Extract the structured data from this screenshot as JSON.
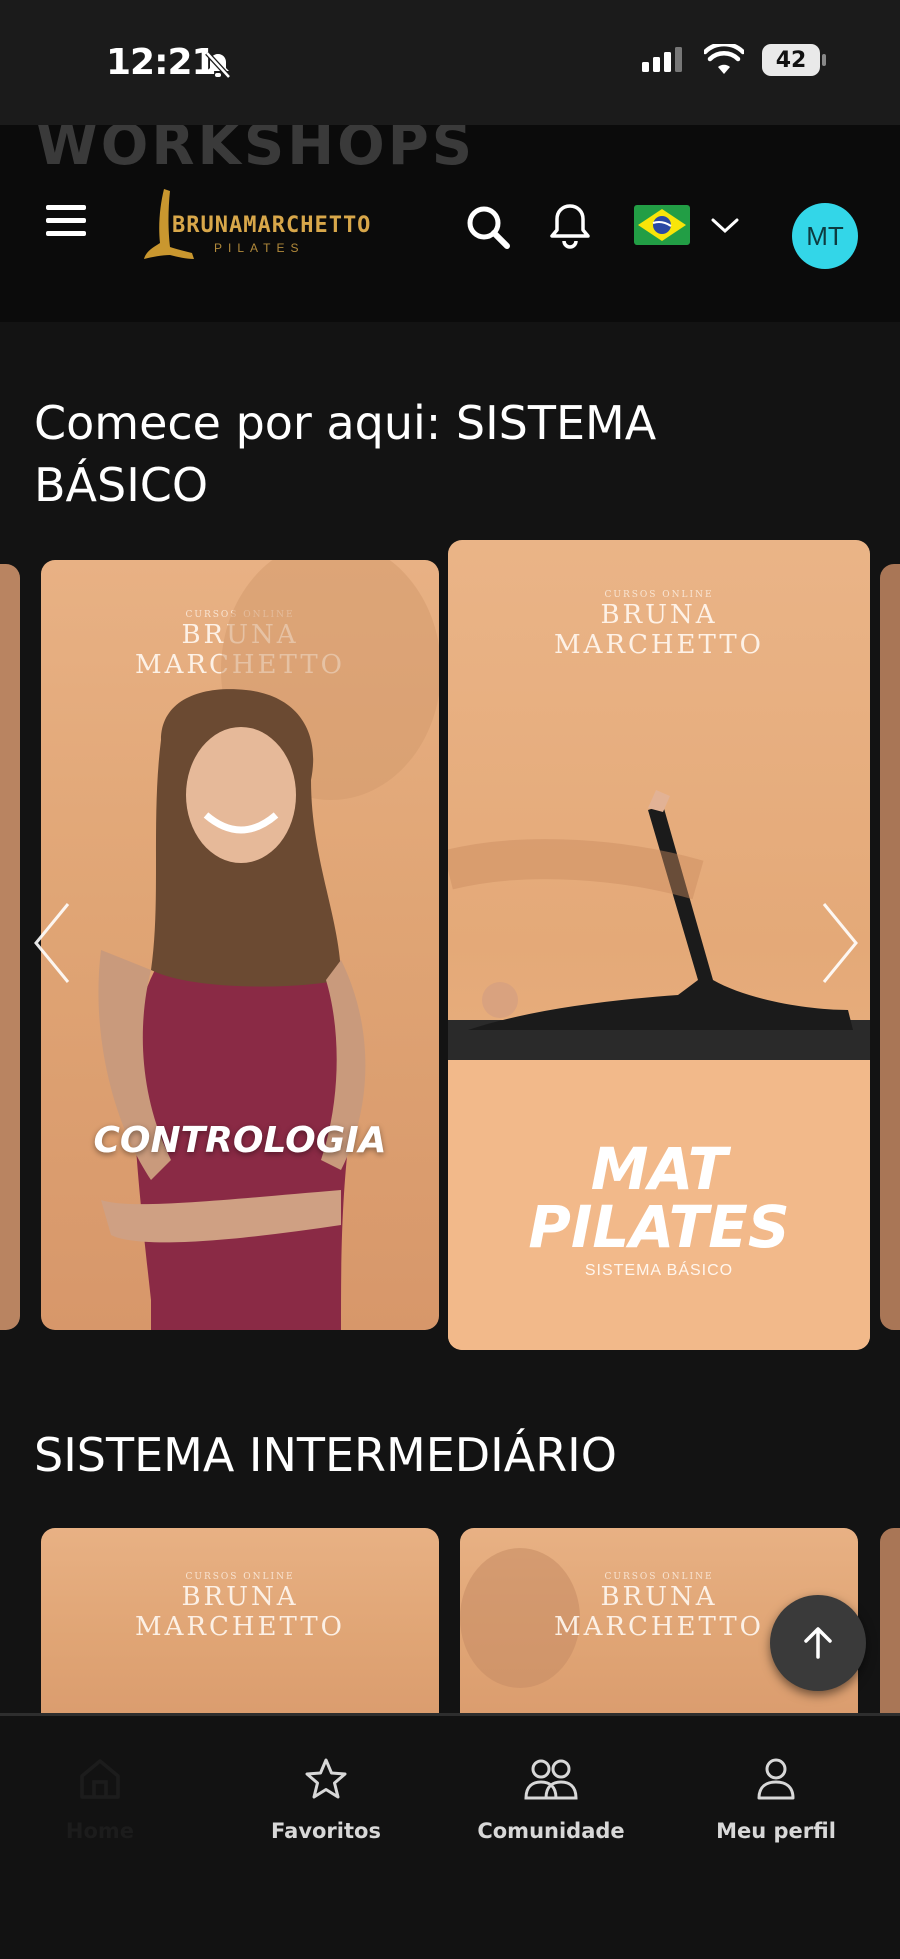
{
  "status_bar": {
    "time": "12:21",
    "battery": "42"
  },
  "header": {
    "ghost_text": "WORKSHOPS",
    "logo_text": "BRUNAMARCHETTO",
    "logo_sub": "PILATES",
    "avatar_initials": "MT",
    "language": "pt-BR"
  },
  "section1": {
    "title_line1": "Comece por aqui: SISTEMA",
    "title_line2": "BÁSICO",
    "cards": [
      {
        "brand_small": "CURSOS ONLINE",
        "brand_line1": "BRUNA",
        "brand_line2": "MARCHETTO",
        "title": "CONTROLOGIA"
      },
      {
        "brand_small": "CURSOS ONLINE",
        "brand_line1": "BRUNA",
        "brand_line2": "MARCHETTO",
        "title_line1": "MAT",
        "title_line2": "PILATES",
        "subtitle": "SISTEMA BÁSICO"
      }
    ]
  },
  "section2": {
    "title": "SISTEMA INTERMEDIÁRIO",
    "cards": [
      {
        "brand_small": "CURSOS ONLINE",
        "brand_line1": "BRUNA",
        "brand_line2": "MARCHETTO"
      },
      {
        "brand_small": "CURSOS ONLINE",
        "brand_line1": "BRUNA",
        "brand_line2": "MARCHETTO"
      }
    ]
  },
  "bottom_nav": {
    "items": [
      {
        "label": "Home",
        "icon": "home-icon",
        "active": true
      },
      {
        "label": "Favoritos",
        "icon": "star-icon"
      },
      {
        "label": "Comunidade",
        "icon": "community-icon"
      },
      {
        "label": "Meu perfil",
        "icon": "profile-icon"
      }
    ]
  },
  "colors": {
    "accent": "#33d6e8",
    "gold": "#d8a74a",
    "card": "#e3a678",
    "background": "#131313"
  }
}
